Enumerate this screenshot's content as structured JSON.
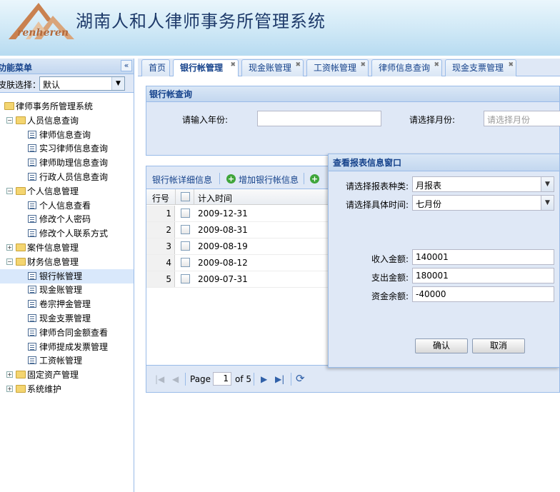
{
  "header": {
    "logo_text": "renheren",
    "app_title": "湖南人和人律师事务所管理系统",
    "colors": {
      "header_bg": "#cfe8f6",
      "title": "#1e3a6a",
      "logo": "#c98150"
    }
  },
  "sidebar": {
    "title": "功能菜单",
    "collapse_icon": "«",
    "skin_label": "皮肤选择：",
    "skin_value": "默认",
    "tree": [
      {
        "label": "律师事务所管理系统",
        "type": "folder",
        "expanded": true
      },
      {
        "label": "人员信息查询",
        "type": "folder",
        "expanded": true
      },
      {
        "label": "律师信息查询",
        "type": "leaf"
      },
      {
        "label": "实习律师信息查询",
        "type": "leaf"
      },
      {
        "label": "律师助理信息查询",
        "type": "leaf"
      },
      {
        "label": "行政人员信息查询",
        "type": "leaf"
      },
      {
        "label": "个人信息管理",
        "type": "folder",
        "expanded": true
      },
      {
        "label": "个人信息查看",
        "type": "leaf"
      },
      {
        "label": "修改个人密码",
        "type": "leaf"
      },
      {
        "label": "修改个人联系方式",
        "type": "leaf"
      },
      {
        "label": "案件信息管理",
        "type": "folder",
        "expanded": false
      },
      {
        "label": "财务信息管理",
        "type": "folder",
        "expanded": true
      },
      {
        "label": "银行帐管理",
        "type": "leaf",
        "selected": true
      },
      {
        "label": "现金账管理",
        "type": "leaf"
      },
      {
        "label": "卷宗押金管理",
        "type": "leaf"
      },
      {
        "label": "现金支票管理",
        "type": "leaf"
      },
      {
        "label": "律师合同金额查看",
        "type": "leaf"
      },
      {
        "label": "律师提成发票管理",
        "type": "leaf"
      },
      {
        "label": "工资帐管理",
        "type": "leaf"
      },
      {
        "label": "固定资产管理",
        "type": "folder",
        "expanded": false
      },
      {
        "label": "系统维护",
        "type": "folder",
        "expanded": false
      }
    ]
  },
  "tabs": [
    {
      "label": "首页",
      "closable": false
    },
    {
      "label": "银行帐管理",
      "closable": true,
      "active": true
    },
    {
      "label": "现金账管理",
      "closable": true
    },
    {
      "label": "工资帐管理",
      "closable": true
    },
    {
      "label": "律师信息查询",
      "closable": true
    },
    {
      "label": "现金支票管理",
      "closable": true
    }
  ],
  "query": {
    "title": "银行帐查询",
    "year_label": "请输入年份:",
    "month_label": "请选择月份:",
    "month_placeholder": "请选择月份"
  },
  "grid": {
    "title": "银行帐详细信息",
    "add_label": "增加银行帐信息",
    "col_rownum": "行号",
    "col_time": "计入时间",
    "rows": [
      {
        "n": "1",
        "date": "2009-12-31"
      },
      {
        "n": "2",
        "date": "2009-08-31"
      },
      {
        "n": "3",
        "date": "2009-08-19"
      },
      {
        "n": "4",
        "date": "2009-08-12"
      },
      {
        "n": "5",
        "date": "2009-07-31"
      }
    ],
    "pager": {
      "page_label": "Page",
      "page": "1",
      "of": "of 5"
    }
  },
  "dialog": {
    "title": "查看报表信息窗口",
    "type_label": "请选择报表种类:",
    "type_value": "月报表",
    "time_label": "请选择具体时间:",
    "time_value": "七月份",
    "income_label": "收入金额:",
    "income_value": "140001",
    "expense_label": "支出金额:",
    "expense_value": "180001",
    "balance_label": "资金余额:",
    "balance_value": "-40000",
    "ok_label": "确认",
    "cancel_label": "取消"
  }
}
